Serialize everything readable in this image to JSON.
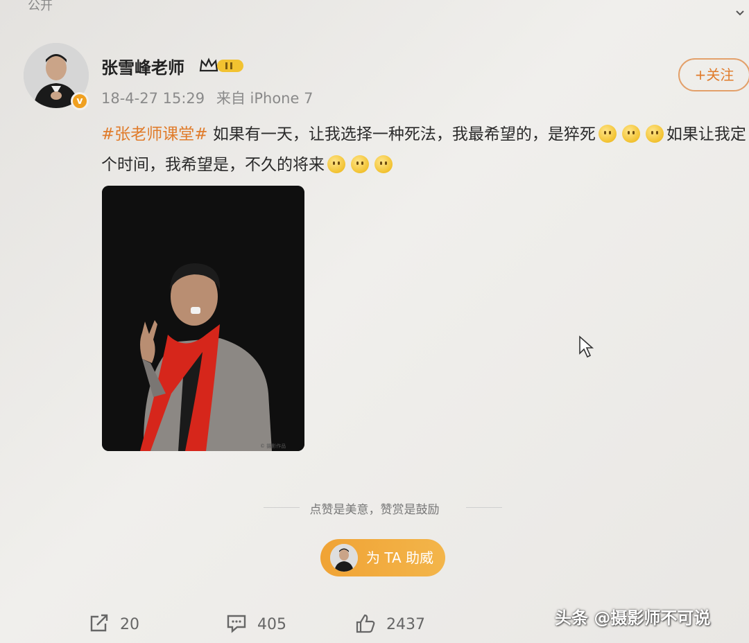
{
  "header": {
    "visibility_label": "公开"
  },
  "post": {
    "author": {
      "name": "张雪峰老师",
      "verified_badge": "v"
    },
    "timestamp": "18-4-27 15:29",
    "source": "来自 iPhone 7",
    "follow_label": "+关注",
    "topic": "#张老师课堂#",
    "text_part1": " 如果有一天，让我选择一种死法，我最希望的，是猝死",
    "text_part2": "如果让我定个时间，我希望是，不久的将来",
    "emoji_name": "smile-emoji"
  },
  "reward": {
    "caption": "点赞是美意，赞赏是鼓励",
    "button_label": "为 TA 助威"
  },
  "actions": {
    "share_count": "20",
    "comment_count": "405",
    "like_count": "2437"
  },
  "watermark": "头条 @摄影师不可说",
  "colors": {
    "accent": "#e07b2a",
    "button": "#f0a335",
    "background": "#ebe9e6"
  }
}
